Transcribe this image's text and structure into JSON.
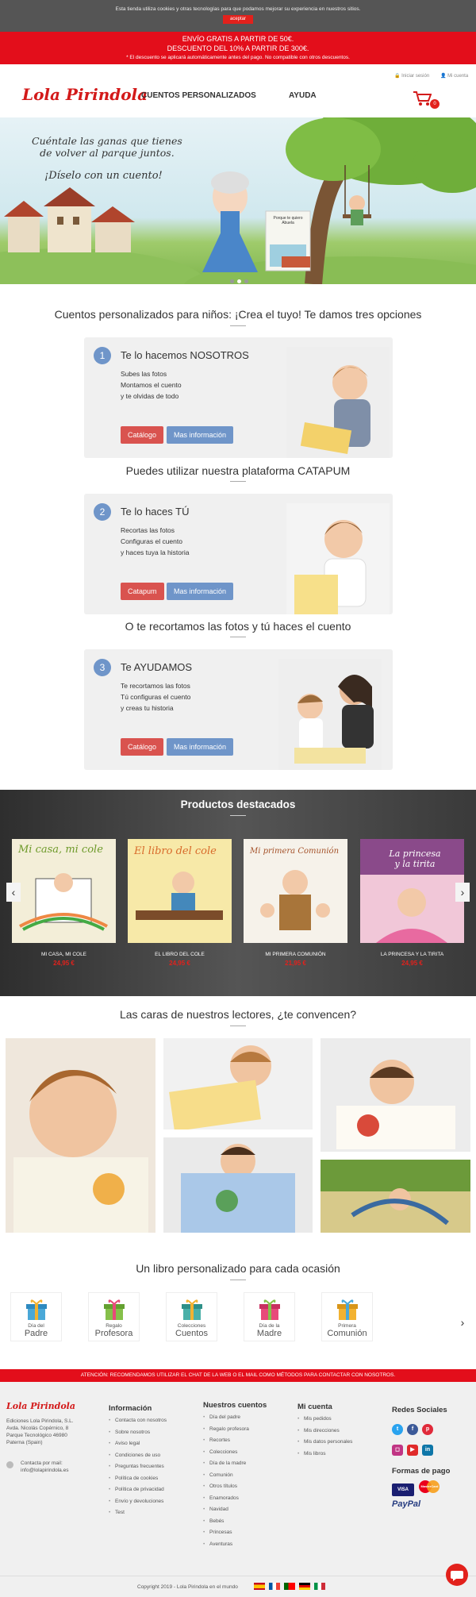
{
  "cookie_bar": {
    "text": "Esta tienda utiliza cookies y otras tecnologías para que podamos mejorar su experiencia en nuestros sitios.",
    "accept_label": "aceptar"
  },
  "promo": {
    "line1": "ENVÍO GRATIS A PARTIR DE 50€.",
    "line2": "DESCUENTO DEL 10% A PARTIR DE 300€.",
    "line3": "* El descuento se aplicará automáticamente antes del pago. No compatible con otros descuentos."
  },
  "topbar": {
    "login": "Iniciar sesión",
    "account": "Mi cuenta"
  },
  "header": {
    "logo": "Lola Pirindola",
    "nav": [
      "CUENTOS PERSONALIZADOS",
      "AYUDA"
    ],
    "cart_count": "0"
  },
  "hero": {
    "line1": "Cuéntale las ganas que tienes",
    "line2": "de volver al parque juntos.",
    "line3": "¡Díselo con un cuento!",
    "book_title": "Porque te quiero Abuela"
  },
  "options": {
    "title": "Cuentos personalizados para niños: ¡Crea el tuyo! Te damos tres opciones",
    "cards": [
      {
        "num": "1",
        "title": "Te lo hacemos NOSOTROS",
        "lines": [
          "Subes las fotos",
          "Montamos el cuento",
          "y te olvidas de todo"
        ],
        "btn1": "Catálogo",
        "btn2": "Mas información"
      },
      {
        "num": "2",
        "title": "Te lo haces TÚ",
        "lines": [
          "Recortas las fotos",
          "Configuras el cuento",
          "y haces tuya la historia"
        ],
        "btn1": "Catapum",
        "btn2": "Mas información"
      },
      {
        "num": "3",
        "title": "Te AYUDAMOS",
        "lines": [
          "Te recortamos las fotos",
          "Tú configuras el cuento",
          "y creas tu historia"
        ],
        "btn1": "Catálogo",
        "btn2": "Mas información"
      }
    ],
    "heading2": "Puedes utilizar nuestra plataforma CATAPUM",
    "heading3": "O te recortamos las fotos y tú haces el cuento"
  },
  "featured": {
    "title": "Productos destacados",
    "products": [
      {
        "name": "MI CASA, MI COLE",
        "price": "24,95 €",
        "cover_title": "Mi casa, mi cole"
      },
      {
        "name": "EL LIBRO DEL COLE",
        "price": "24,95 €",
        "cover_title": "El libro del cole"
      },
      {
        "name": "MI PRIMERA COMUNIÓN",
        "price": "21,95 €",
        "cover_title": "Mi primera Comunión"
      },
      {
        "name": "LA PRINCESA Y LA TIRITA",
        "price": "24,95 €",
        "cover_title": "La princesa y la tirita"
      }
    ]
  },
  "readers": {
    "title": "Las caras de nuestros lectores, ¿te convencen?"
  },
  "occasions": {
    "title": "Un libro personalizado para cada ocasión",
    "items": [
      {
        "small": "Día del",
        "big": "Padre"
      },
      {
        "small": "Regalo",
        "big": "Profesora"
      },
      {
        "small": "Colecciones",
        "big": "Cuentos"
      },
      {
        "small": "Día de la",
        "big": "Madre"
      },
      {
        "small": "Primera",
        "big": "Comunión"
      }
    ]
  },
  "notice": "ATENCIÓN: RECOMENDAMOS UTILIZAR EL CHAT DE LA WEB O EL MAIL COMO MÉTODOS PARA CONTACTAR CON NOSOTROS.",
  "footer": {
    "logo": "Lola Pirindola",
    "address": [
      "Ediciones Lola Pirindola, S.L.",
      "Avda. Nicolás Copérnico, 8",
      "Parque Tecnológico 46980",
      "Paterna (Spain)"
    ],
    "contact": [
      "Contacta por mail:",
      "info@lolapirindola.es"
    ],
    "info": {
      "title": "Información",
      "items": [
        "Contacta con nosotros",
        "Sobre nosotros",
        "Aviso legal",
        "Condiciones de uso",
        "Preguntas frecuentes",
        "Política de cookies",
        "Política de privacidad",
        "Envío y devoluciones",
        "Test"
      ]
    },
    "stories": {
      "title": "Nuestros cuentos",
      "items": [
        "Día del padre",
        "Regalo profesora",
        "Recortes",
        "Colecciones",
        "Día de la madre",
        "Comunión",
        "Otros títulos",
        "Enamorados",
        "Navidad",
        "Bebés",
        "Princesas",
        "Aventuras"
      ]
    },
    "account": {
      "title": "Mi cuenta",
      "items": [
        "Mis pedidos",
        "Mis direcciones",
        "Mis datos personales",
        "Mis libros"
      ]
    },
    "social_title": "Redes Sociales",
    "payment_title": "Formas de pago",
    "payments": [
      "VISA",
      "MasterCard",
      "PayPal"
    ],
    "copyright": "Copyright 2019 - Lola Pirindola en el mundo"
  },
  "colors": {
    "brand_red": "#e30e1b",
    "button_red": "#d9534f",
    "button_blue": "#6f95c9",
    "footer_bg": "#f0f0f0"
  }
}
